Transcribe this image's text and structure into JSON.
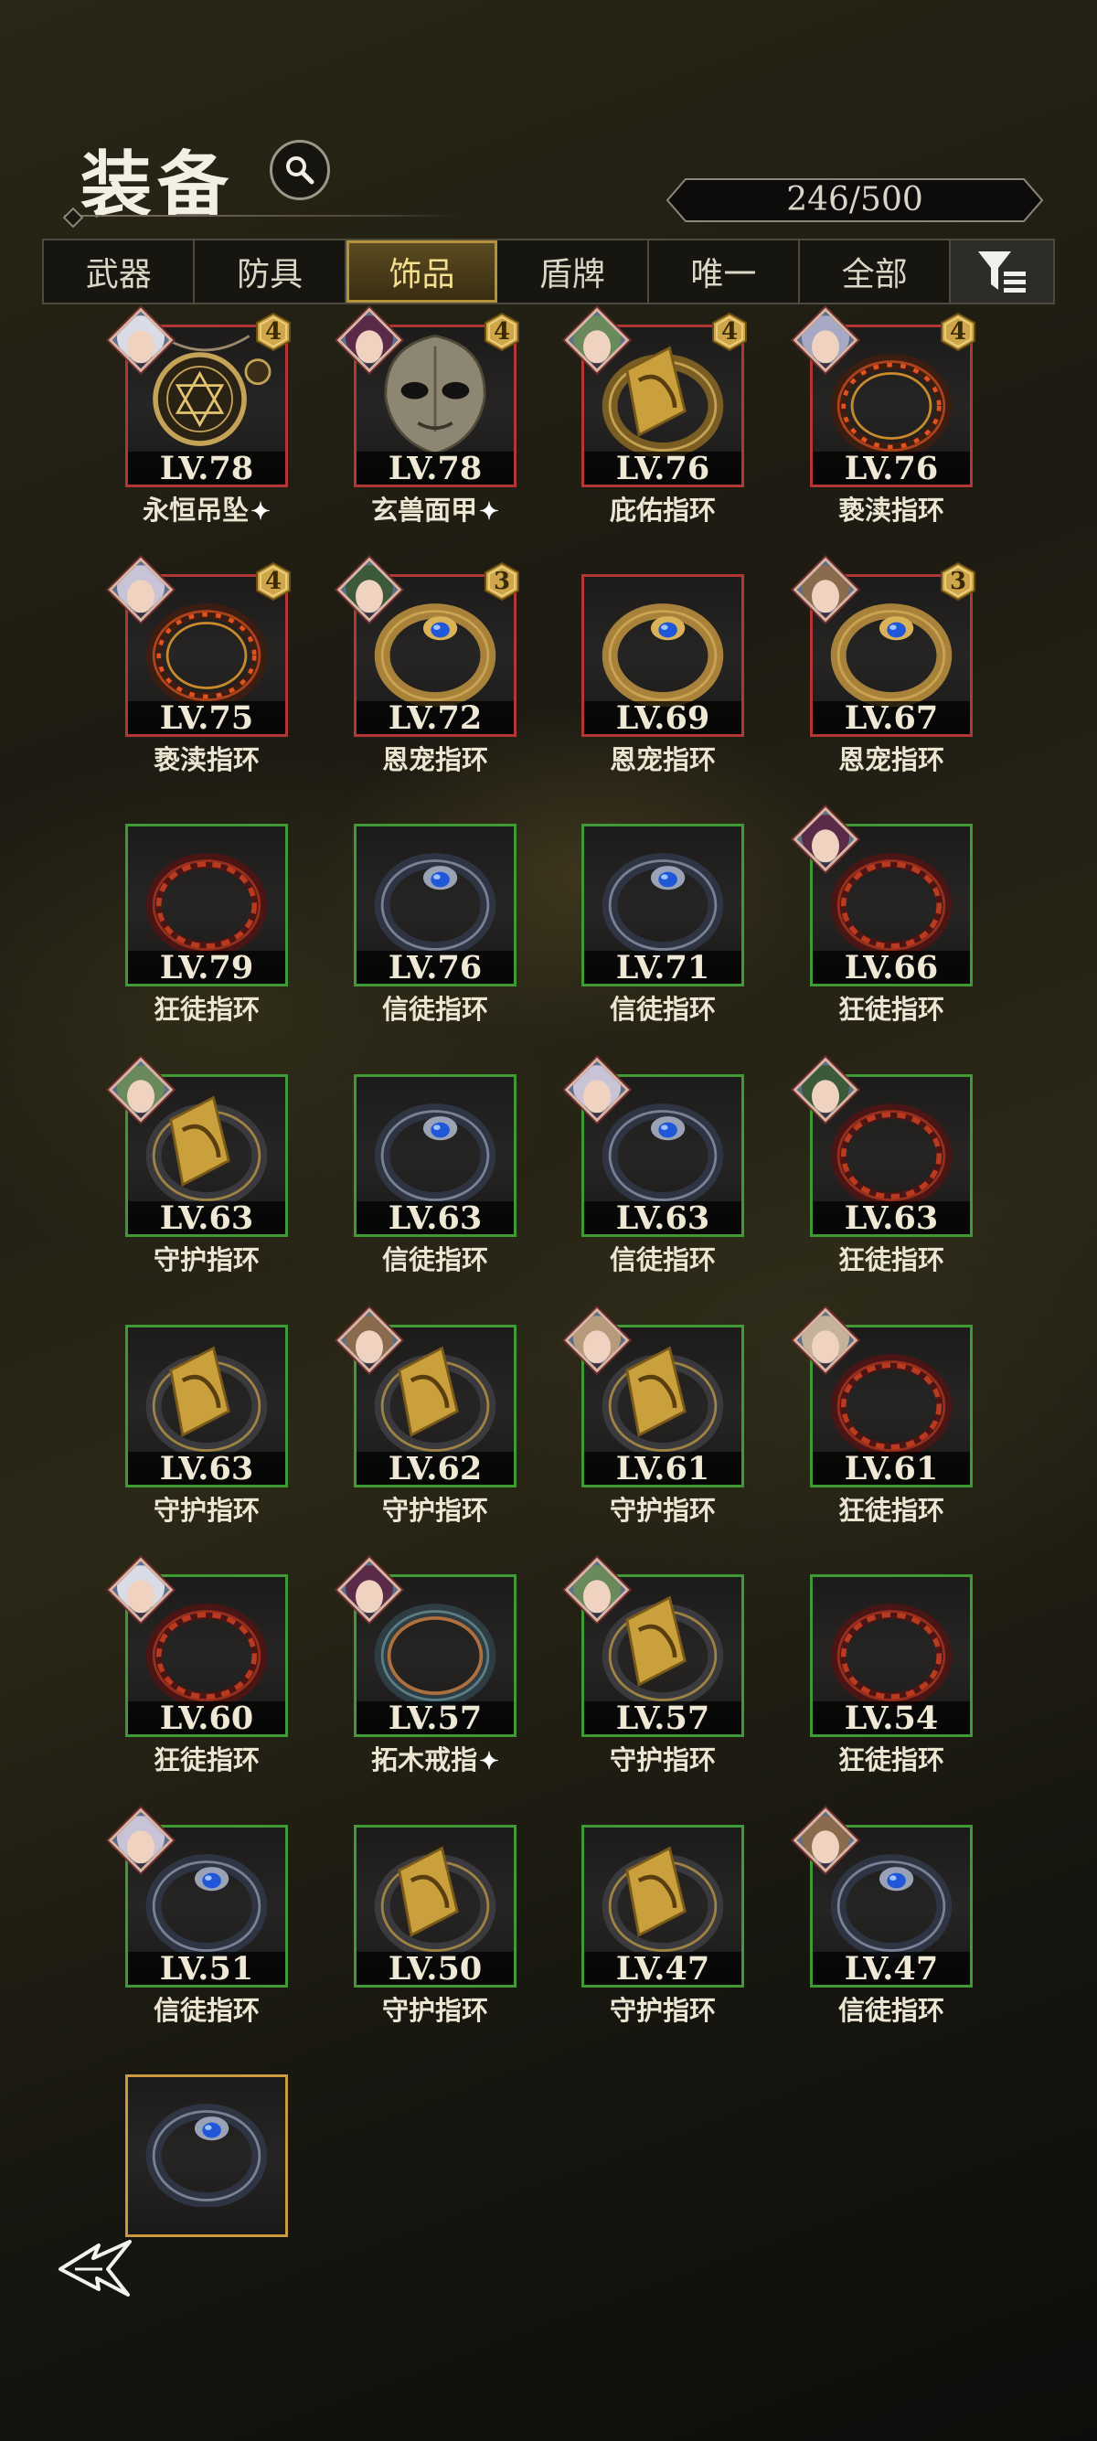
{
  "header": {
    "title": "装备",
    "capacity": "246/500"
  },
  "tabs": [
    {
      "label": "武器",
      "active": false
    },
    {
      "label": "防具",
      "active": false
    },
    {
      "label": "饰品",
      "active": true
    },
    {
      "label": "盾牌",
      "active": false
    },
    {
      "label": "唯一",
      "active": false
    },
    {
      "label": "全部",
      "active": false
    }
  ],
  "colors": {
    "red_frame": "#b33636",
    "green_frame": "#3f9a36",
    "gold_frame": "#c99a3f",
    "active_tab": "#f6df8e"
  },
  "items": [
    {
      "level": "LV.78",
      "name": "永恒吊坠",
      "star": true,
      "badge": "4",
      "border": "red",
      "icon": "pendant-icon",
      "avatar": "hero-portrait-icon"
    },
    {
      "level": "LV.78",
      "name": "玄兽面甲",
      "star": true,
      "badge": "4",
      "border": "red",
      "icon": "mask-icon",
      "avatar": "hero-portrait-icon"
    },
    {
      "level": "LV.76",
      "name": "庇佑指环",
      "star": false,
      "badge": "4",
      "border": "red",
      "icon": "gold-signet-ring-icon",
      "avatar": "hero-portrait-icon"
    },
    {
      "level": "LV.76",
      "name": "亵渎指环",
      "star": false,
      "badge": "4",
      "border": "red",
      "icon": "flame-ring-icon",
      "avatar": "hero-portrait-icon"
    },
    {
      "level": "LV.75",
      "name": "亵渎指环",
      "star": false,
      "badge": "4",
      "border": "red",
      "icon": "flame-ring-icon",
      "avatar": "hero-portrait-icon"
    },
    {
      "level": "LV.72",
      "name": "恩宠指环",
      "star": false,
      "badge": "3",
      "border": "red",
      "icon": "gold-gem-ring-icon",
      "avatar": "hero-portrait-icon"
    },
    {
      "level": "LV.69",
      "name": "恩宠指环",
      "star": false,
      "badge": "",
      "border": "red",
      "icon": "gold-gem-ring-icon",
      "avatar": ""
    },
    {
      "level": "LV.67",
      "name": "恩宠指环",
      "star": false,
      "badge": "3",
      "border": "red",
      "icon": "gold-gem-ring-icon",
      "avatar": "hero-portrait-icon"
    },
    {
      "level": "LV.79",
      "name": "狂徒指环",
      "star": false,
      "badge": "",
      "border": "green",
      "icon": "chain-ring-icon",
      "avatar": ""
    },
    {
      "level": "LV.76",
      "name": "信徒指环",
      "star": false,
      "badge": "",
      "border": "green",
      "icon": "sapphire-ring-icon",
      "avatar": ""
    },
    {
      "level": "LV.71",
      "name": "信徒指环",
      "star": false,
      "badge": "",
      "border": "green",
      "icon": "sapphire-ring-icon",
      "avatar": ""
    },
    {
      "level": "LV.66",
      "name": "狂徒指环",
      "star": false,
      "badge": "",
      "border": "green",
      "icon": "chain-ring-icon",
      "avatar": "hero-portrait-icon"
    },
    {
      "level": "LV.63",
      "name": "守护指环",
      "star": false,
      "badge": "",
      "border": "green",
      "icon": "guard-ring-icon",
      "avatar": "hero-portrait-icon"
    },
    {
      "level": "LV.63",
      "name": "信徒指环",
      "star": false,
      "badge": "",
      "border": "green",
      "icon": "sapphire-ring-icon",
      "avatar": ""
    },
    {
      "level": "LV.63",
      "name": "信徒指环",
      "star": false,
      "badge": "",
      "border": "green",
      "icon": "sapphire-ring-icon",
      "avatar": "hero-portrait-icon"
    },
    {
      "level": "LV.63",
      "name": "狂徒指环",
      "star": false,
      "badge": "",
      "border": "green",
      "icon": "chain-ring-icon",
      "avatar": "hero-portrait-icon"
    },
    {
      "level": "LV.63",
      "name": "守护指环",
      "star": false,
      "badge": "",
      "border": "green",
      "icon": "guard-ring-icon",
      "avatar": ""
    },
    {
      "level": "LV.62",
      "name": "守护指环",
      "star": false,
      "badge": "",
      "border": "green",
      "icon": "guard-ring-icon",
      "avatar": "hero-portrait-icon"
    },
    {
      "level": "LV.61",
      "name": "守护指环",
      "star": false,
      "badge": "",
      "border": "green",
      "icon": "guard-ring-icon",
      "avatar": "hero-portrait-icon"
    },
    {
      "level": "LV.61",
      "name": "狂徒指环",
      "star": false,
      "badge": "",
      "border": "green",
      "icon": "chain-ring-icon",
      "avatar": "hero-portrait-icon"
    },
    {
      "level": "LV.60",
      "name": "狂徒指环",
      "star": false,
      "badge": "",
      "border": "green",
      "icon": "chain-ring-icon",
      "avatar": "hero-portrait-icon"
    },
    {
      "level": "LV.57",
      "name": "拓木戒指",
      "star": true,
      "badge": "",
      "border": "green",
      "icon": "wood-ring-icon",
      "avatar": "hero-portrait-icon"
    },
    {
      "level": "LV.57",
      "name": "守护指环",
      "star": false,
      "badge": "",
      "border": "green",
      "icon": "guard-ring-icon",
      "avatar": "hero-portrait-icon"
    },
    {
      "level": "LV.54",
      "name": "狂徒指环",
      "star": false,
      "badge": "",
      "border": "green",
      "icon": "chain-ring-icon",
      "avatar": ""
    },
    {
      "level": "LV.51",
      "name": "信徒指环",
      "star": false,
      "badge": "",
      "border": "green",
      "icon": "sapphire-ring-icon",
      "avatar": "hero-portrait-icon"
    },
    {
      "level": "LV.50",
      "name": "守护指环",
      "star": false,
      "badge": "",
      "border": "green",
      "icon": "guard-ring-icon",
      "avatar": ""
    },
    {
      "level": "LV.47",
      "name": "守护指环",
      "star": false,
      "badge": "",
      "border": "green",
      "icon": "guard-ring-icon",
      "avatar": ""
    },
    {
      "level": "LV.47",
      "name": "信徒指环",
      "star": false,
      "badge": "",
      "border": "green",
      "icon": "sapphire-ring-icon",
      "avatar": "hero-portrait-icon"
    },
    {
      "level": "",
      "name": "",
      "star": false,
      "badge": "",
      "border": "gold",
      "icon": "sapphire-ring-icon",
      "avatar": ""
    }
  ]
}
